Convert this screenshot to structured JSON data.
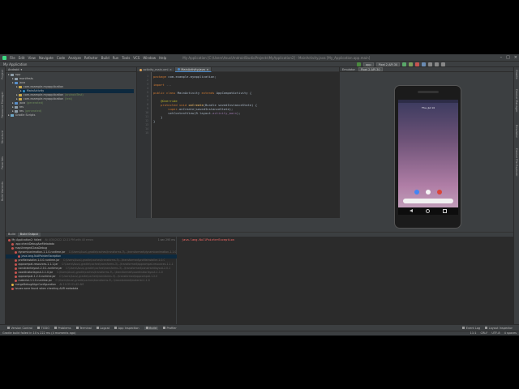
{
  "menu": {
    "items": [
      "File",
      "Edit",
      "View",
      "Navigate",
      "Code",
      "Analyze",
      "Refactor",
      "Build",
      "Run",
      "Tools",
      "VCS",
      "Window",
      "Help"
    ],
    "window_title": "My Application [C:\\Users\\Asus\\AndroidStudioProjects\\MyApplication2] - MainActivity.java [My_Application.app.main]"
  },
  "toolbar": {
    "breadcrumb": "My Application",
    "app_config": "app",
    "device": "Pixel 2 API 30"
  },
  "sidebar_left": [
    "Project",
    "Resource Manager",
    "Structure",
    "Favorites",
    "Build Variants"
  ],
  "sidebar_right": [
    "Gradle",
    "Device Manager",
    "Emulator",
    "Device File Explorer"
  ],
  "project": {
    "view_label": "Android",
    "tree": [
      {
        "label": "app",
        "indent": 0,
        "kind": "folder"
      },
      {
        "label": "manifests",
        "indent": 1,
        "kind": "folder"
      },
      {
        "label": "java",
        "indent": 1,
        "kind": "folder"
      },
      {
        "label": "com.example.myapplication",
        "indent": 2,
        "kind": "package"
      },
      {
        "label": "MainActivity",
        "indent": 3,
        "kind": "class",
        "selected": true
      },
      {
        "label": "com.example.myapplication",
        "suffix": "(androidTest)",
        "indent": 2,
        "kind": "package"
      },
      {
        "label": "com.example.myapplication",
        "suffix": "(test)",
        "indent": 2,
        "kind": "package"
      },
      {
        "label": "java",
        "suffix": "(generated)",
        "indent": 1,
        "kind": "folder"
      },
      {
        "label": "res",
        "indent": 1,
        "kind": "folder"
      },
      {
        "label": "res",
        "suffix": "(generated)",
        "indent": 1,
        "kind": "folder"
      },
      {
        "label": "Gradle Scripts",
        "indent": 0,
        "kind": "gradle"
      }
    ]
  },
  "editor": {
    "tabs": [
      {
        "label": "activity_main.xml",
        "active": false,
        "color": "#e0a458"
      },
      {
        "label": "MainActivity.java",
        "active": true,
        "color": "#4a88c7"
      }
    ],
    "line_numbers": [
      "1",
      "2",
      "3",
      "4",
      "5",
      "6",
      "7",
      "8",
      "9",
      "10",
      "11",
      "12",
      "13",
      "14",
      "15"
    ],
    "lines": [
      {
        "segments": [
          [
            "kw",
            "package "
          ],
          [
            "id",
            "com.example.myapplication;"
          ]
        ]
      },
      {
        "segments": []
      },
      {
        "segments": [
          [
            "kw",
            "import "
          ],
          [
            "cmt",
            "..."
          ]
        ]
      },
      {
        "segments": []
      },
      {
        "segments": [
          [
            "kw",
            "public class "
          ],
          [
            "id",
            "MainActivity "
          ],
          [
            "kw",
            "extends "
          ],
          [
            "id",
            "AppCompatActivity {"
          ]
        ]
      },
      {
        "segments": []
      },
      {
        "segments": [
          [
            "ann",
            "    @Override"
          ]
        ]
      },
      {
        "segments": [
          [
            "kw",
            "    protected void "
          ],
          [
            "fn",
            "onCreate"
          ],
          [
            "id",
            "(Bundle savedInstanceState) {"
          ]
        ]
      },
      {
        "segments": [
          [
            "kw",
            "        super"
          ],
          [
            "id",
            ".onCreate(savedInstanceState);"
          ]
        ]
      },
      {
        "segments": [
          [
            "id",
            "        setContentView(R.layout."
          ],
          [
            "fld",
            "activity_main"
          ],
          [
            "id",
            ");"
          ]
        ]
      },
      {
        "segments": [
          [
            "id",
            "    }"
          ]
        ]
      },
      {
        "segments": [
          [
            "id",
            "}"
          ]
        ]
      }
    ]
  },
  "emulator": {
    "tab_label": "Emulator",
    "device_tab": "Pixel 2 API 30",
    "clock": "Thu, Jul 14"
  },
  "build": {
    "tabs": [
      "Build",
      "Build Output"
    ],
    "rows": [
      {
        "label": "My Application2: failed",
        "meta": "At 4/30/2022 12:21 PM with 40 errors",
        "time": "1 sec 295 ms",
        "status": "error",
        "indent": 0
      },
      {
        "label": ":app:checkDebugAarMetadata",
        "meta": "",
        "time": "",
        "status": "error",
        "indent": 1
      },
      {
        "label": "mapUnregedClassDebug",
        "meta": "",
        "time": "",
        "status": "error",
        "indent": 1
      },
      {
        "label": "dynamicanimation-1.1.0-runtime.jar",
        "meta": "C:\\Users\\Asus\\.gradle\\caches\\transforms-3\\...\\transformed\\dynamicanimation-1.1.0",
        "time": "",
        "status": "error",
        "indent": 2
      },
      {
        "label": "java.lang.NullPointerException",
        "meta": "",
        "time": "",
        "status": "error",
        "indent": 3,
        "selected": true
      },
      {
        "label": "profileinstaller-1.0.0-runtime.jar",
        "meta": "C:\\Users\\Asus\\.gradle\\caches\\transforms-3\\...\\transformed\\profileinstaller-1.0.0",
        "time": "",
        "status": "error",
        "indent": 2
      },
      {
        "label": "appcompat-resources-1.1.1.jar",
        "meta": "C:\\Users\\Asus\\.gradle\\caches\\transforms-3\\...\\transformed\\appcompat-resources-1.1.1",
        "time": "",
        "status": "error",
        "indent": 2
      },
      {
        "label": "constraintlayout-2.0.1-runtime.jar",
        "meta": "C:\\Users\\Asus\\.gradle\\caches\\transforms-3\\...\\transformed\\constraintlayout-2.0.1",
        "time": "",
        "status": "error",
        "indent": 2
      },
      {
        "label": "coordinatorlayout-1.1.0.jar",
        "meta": "C:\\Users\\Asus\\.gradle\\caches\\transforms-3\\...\\transformed\\coordinatorlayout-1.1.0",
        "time": "",
        "status": "error",
        "indent": 2
      },
      {
        "label": "appcompat-1.2.0-runtime.jar",
        "meta": "C:\\Users\\Asus\\.gradle\\caches\\transforms-3\\...\\transformed\\appcompat-1.2.0",
        "time": "",
        "status": "error",
        "indent": 2
      },
      {
        "label": "material-1.1.0-runtime.jar",
        "meta": "C:\\Users\\Asus\\.gradle\\caches\\transforms-3\\...\\transformed\\material-1.1.0",
        "time": "",
        "status": "error",
        "indent": 2
      },
      {
        "label": "mergeDebugAlignConfiguration",
        "meta": "At 10:35 01:42 AM",
        "time": "",
        "status": "warn",
        "indent": 1
      },
      {
        "label": "Issues were found when checking AAR metadata",
        "meta": "",
        "time": "",
        "status": "error",
        "indent": 1
      }
    ],
    "detail": "java.lang.NullPointerException"
  },
  "bottom_tools": [
    {
      "label": "Version Control",
      "active": false
    },
    {
      "label": "TODO",
      "active": false
    },
    {
      "label": "Problems",
      "active": false
    },
    {
      "label": "Terminal",
      "active": false
    },
    {
      "label": "Logcat",
      "active": false
    },
    {
      "label": "App Inspection",
      "active": false
    },
    {
      "label": "Build",
      "active": true
    },
    {
      "label": "Profiler",
      "active": false
    }
  ],
  "bottom_tools_right": [
    "Event Log",
    "Layout Inspector"
  ],
  "status": {
    "message": "Gradle build failed in 10 s 222 ms (4 moments ago)",
    "right": [
      "11:1",
      "CRLF",
      "UTF-8",
      "4 spaces"
    ]
  }
}
